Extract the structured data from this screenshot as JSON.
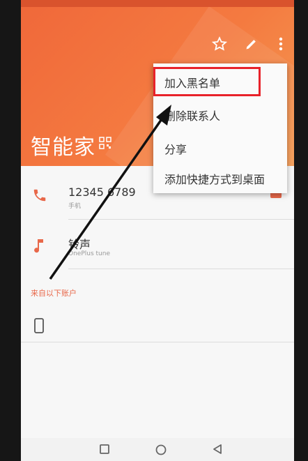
{
  "contact": {
    "name": "智能家"
  },
  "phone": {
    "number": "12345 6789",
    "label": "手机"
  },
  "ringtone": {
    "label": "铃声",
    "value": "OnePlus tune"
  },
  "accounts_section": "来自以下账户",
  "menu": {
    "items": [
      {
        "label": "加入黑名单"
      },
      {
        "label": "删除联系人"
      },
      {
        "label": "分享"
      },
      {
        "label": "添加快捷方式到桌面"
      }
    ]
  },
  "colors": {
    "accent": "#f0683a",
    "highlight": "#e8222a"
  },
  "icons": [
    "star-icon",
    "edit-icon",
    "more-icon",
    "qr-icon",
    "phone-icon",
    "music-icon",
    "device-icon",
    "message-icon"
  ]
}
